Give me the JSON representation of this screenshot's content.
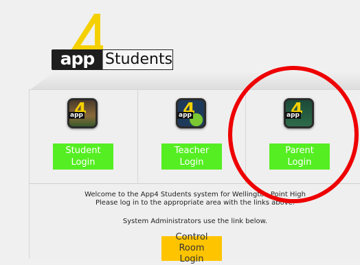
{
  "logo": {
    "app_text": "app",
    "students_text": "Students"
  },
  "roles": [
    {
      "line1": "Student",
      "line2": "Login"
    },
    {
      "line1": "Teacher",
      "line2": "Login"
    },
    {
      "line1": "Parent",
      "line2": "Login"
    }
  ],
  "welcome": {
    "line1": "Welcome to the App4 Students system for Wellington Point High",
    "line2": "Please log in to the appropriate area with the links above."
  },
  "admin_text": "System Administrators use the link below.",
  "control_room": {
    "line1": "Control Room",
    "line2": "Login"
  },
  "colors": {
    "login_button": "#55ee22",
    "control_button": "#ffc400",
    "highlight": "#ee0000"
  }
}
